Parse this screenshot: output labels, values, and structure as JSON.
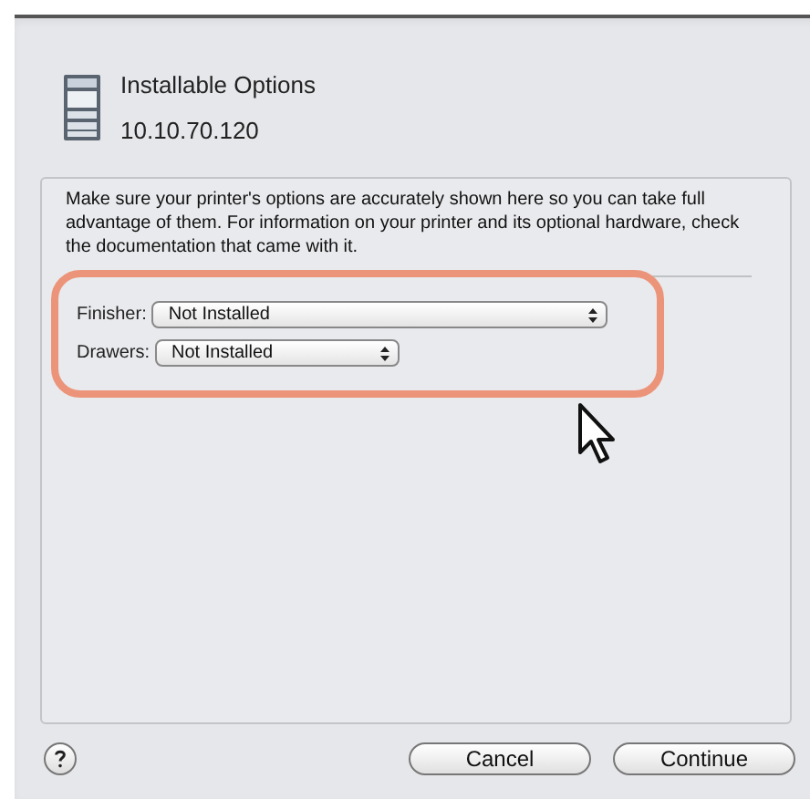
{
  "sheet": {
    "title": "Installable Options",
    "subtitle": "10.10.70.120"
  },
  "message": "Make sure your printer's options are accurately shown here so you can take full advantage of them.  For information on your printer and its optional hardware, check the documentation that came with it.",
  "options": [
    {
      "label": "Finisher:",
      "value": "Not Installed",
      "kind": "wide"
    },
    {
      "label": "Drawers:",
      "value": "Not Installed",
      "kind": "narrow"
    }
  ],
  "buttons": [
    "Cancel",
    "Continue"
  ]
}
